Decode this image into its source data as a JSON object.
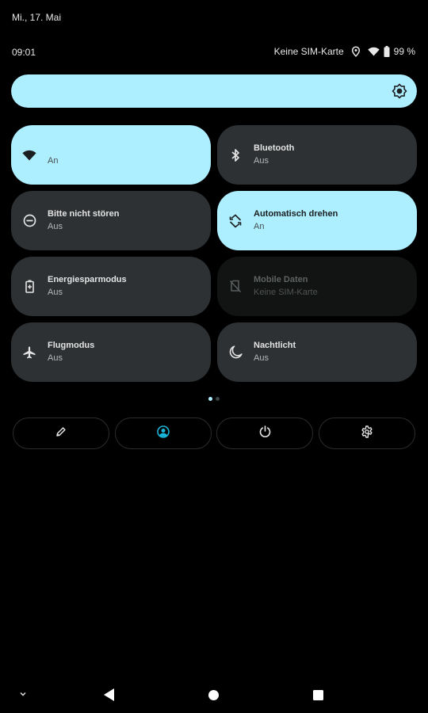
{
  "status_bar": {
    "date": "Mi., 17. Mai",
    "time": "09:01",
    "carrier": "Keine SIM-Karte",
    "icons": [
      "location-icon",
      "wifi-icon",
      "battery-icon"
    ],
    "battery": "99 %"
  },
  "brightness": {
    "level_percent": 100,
    "icon": "brightness-icon",
    "fill_color": "#adeeff"
  },
  "tiles": [
    {
      "id": "wifi",
      "icon": "wifi-icon",
      "title": "",
      "subtitle": "An",
      "state": "on"
    },
    {
      "id": "bluetooth",
      "icon": "bluetooth-icon",
      "title": "Bluetooth",
      "subtitle": "Aus",
      "state": "off"
    },
    {
      "id": "dnd",
      "icon": "do-not-disturb-icon",
      "title": "Bitte nicht stören",
      "subtitle": "Aus",
      "state": "off"
    },
    {
      "id": "autorotate",
      "icon": "auto-rotate-icon",
      "title": "Automatisch drehen",
      "subtitle": "An",
      "state": "on"
    },
    {
      "id": "battery-saver",
      "icon": "battery-saver-icon",
      "title": "Energiesparmodus",
      "subtitle": "Aus",
      "state": "off"
    },
    {
      "id": "mobile-data",
      "icon": "no-sim-icon",
      "title": "Mobile Daten",
      "subtitle": "Keine SIM-Karte",
      "state": "disabled"
    },
    {
      "id": "airplane",
      "icon": "airplane-icon",
      "title": "Flugmodus",
      "subtitle": "Aus",
      "state": "off"
    },
    {
      "id": "night-light",
      "icon": "moon-icon",
      "title": "Nachtlicht",
      "subtitle": "Aus",
      "state": "off"
    }
  ],
  "pager": {
    "pages": 2,
    "current": 1
  },
  "footer": {
    "buttons": [
      {
        "id": "edit",
        "icon": "pencil-icon"
      },
      {
        "id": "user",
        "icon": "user-account-icon"
      },
      {
        "id": "power",
        "icon": "power-icon"
      },
      {
        "id": "settings",
        "icon": "gear-icon"
      }
    ]
  },
  "colors": {
    "accent": "#adeeff",
    "tile_off": "#2d3133",
    "tile_disabled": "#121414",
    "user_icon": "#1ab4d8"
  },
  "navbar": {
    "items": [
      "collapse-chevron-icon",
      "back-icon",
      "home-icon",
      "recents-icon"
    ]
  }
}
